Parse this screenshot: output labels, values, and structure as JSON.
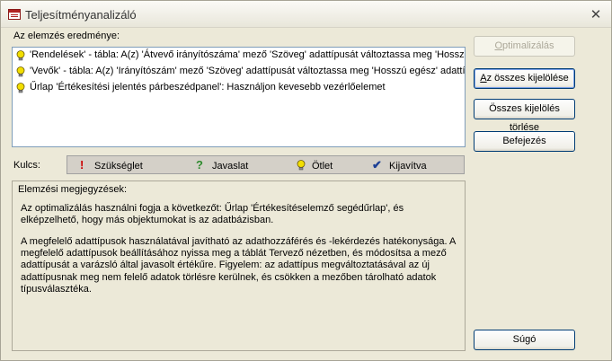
{
  "window": {
    "title": "Teljesítményanalizáló",
    "close_glyph": "✕"
  },
  "results": {
    "label": "Az elemzés eredménye:",
    "items": [
      {
        "icon": "lightbulb-icon",
        "text": "'Rendelések' - tábla: A(z) 'Átvevő irányítószáma' mező 'Szöveg' adattípusát változtassa meg 'Hosszú"
      },
      {
        "icon": "lightbulb-icon",
        "text": "'Vevők' - tábla: A(z) 'Irányítószám' mező 'Szöveg' adattípusát változtassa meg 'Hosszú egész' adattí"
      },
      {
        "icon": "lightbulb-icon",
        "text": "Űrlap 'Értékesítési jelentés párbeszédpanel': Használjon kevesebb vezérlőelemet"
      }
    ]
  },
  "buttons": {
    "optimize": {
      "pre": "",
      "u": "O",
      "post": "ptimalizálás"
    },
    "select_all": {
      "pre": "",
      "u": "A",
      "post": "z összes kijelölése"
    },
    "clear_all": {
      "pre": "Összes kijelölés ",
      "u": "t",
      "post": "örlése"
    },
    "close": {
      "pre": "Befejezés",
      "u": "",
      "post": ""
    },
    "help": {
      "pre": "Súgó",
      "u": "",
      "post": ""
    }
  },
  "key": {
    "label": "Kulcs:",
    "items": [
      {
        "icon": "exclamation-icon",
        "glyph": "!",
        "color": "#cc0000",
        "text": "Szükséglet"
      },
      {
        "icon": "question-icon",
        "glyph": "?",
        "color": "#2e8b2e",
        "text": "Javaslat"
      },
      {
        "icon": "lightbulb-icon",
        "glyph": "",
        "color": "#e8d000",
        "text": "Ötlet"
      },
      {
        "icon": "checkmark-icon",
        "glyph": "✔",
        "color": "#1c3f95",
        "text": "Kijavítva"
      }
    ]
  },
  "notes": {
    "title": "Elemzési megjegyzések:",
    "paragraph1": "Az optimalizálás használni fogja a következőt: Űrlap 'Értékesítéselemző segédűrlap', és elképzelhető, hogy más objektumokat is az adatbázisban.",
    "paragraph2": "A megfelelő adattípusok használatával javítható az adathozzáférés és -lekérdezés hatékonysága. A megfelelő adattípusok beállításához nyissa meg a táblát Tervező nézetben, és módosítsa a mező adattípusát a varázsló által javasolt értékűre. Figyelem: az adattípus megváltoztatásával az új adattípusnak meg nem felelő adatok törlésre kerülnek, és csökken a mezőben tárolható adatok típusválasztéka."
  }
}
